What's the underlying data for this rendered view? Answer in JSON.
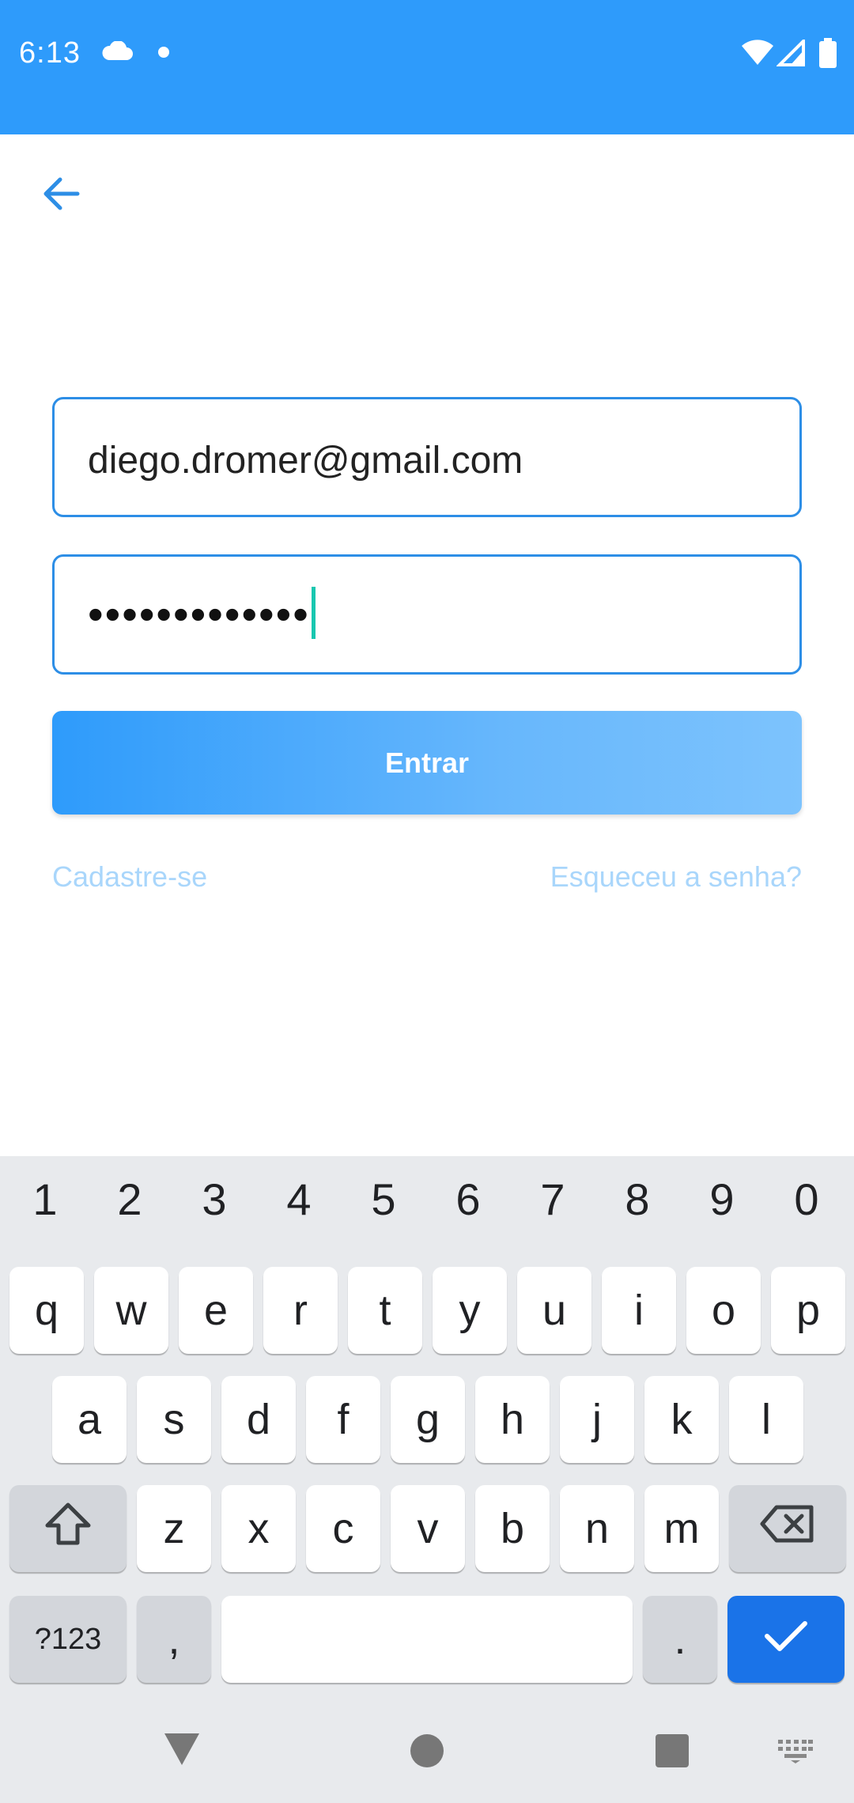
{
  "status_bar": {
    "time": "6:13",
    "color": "#2e9bfb"
  },
  "login": {
    "email_value": "diego.dromer@gmail.com",
    "password_mask": "•••••••••••••",
    "submit_label": "Entrar",
    "signup_link": "Cadastre-se",
    "forgot_link": "Esqueceu a senha?"
  },
  "keyboard": {
    "numbers": [
      "1",
      "2",
      "3",
      "4",
      "5",
      "6",
      "7",
      "8",
      "9",
      "0"
    ],
    "row1": [
      "q",
      "w",
      "e",
      "r",
      "t",
      "y",
      "u",
      "i",
      "o",
      "p"
    ],
    "row2": [
      "a",
      "s",
      "d",
      "f",
      "g",
      "h",
      "j",
      "k",
      "l"
    ],
    "row3": [
      "z",
      "x",
      "c",
      "v",
      "b",
      "n",
      "m"
    ],
    "symbols_label": "?123",
    "comma_label": ",",
    "period_label": "."
  },
  "icons": {
    "back": "arrow-left-icon",
    "shift": "shift-icon",
    "backspace": "backspace-icon",
    "enter": "check-icon"
  }
}
